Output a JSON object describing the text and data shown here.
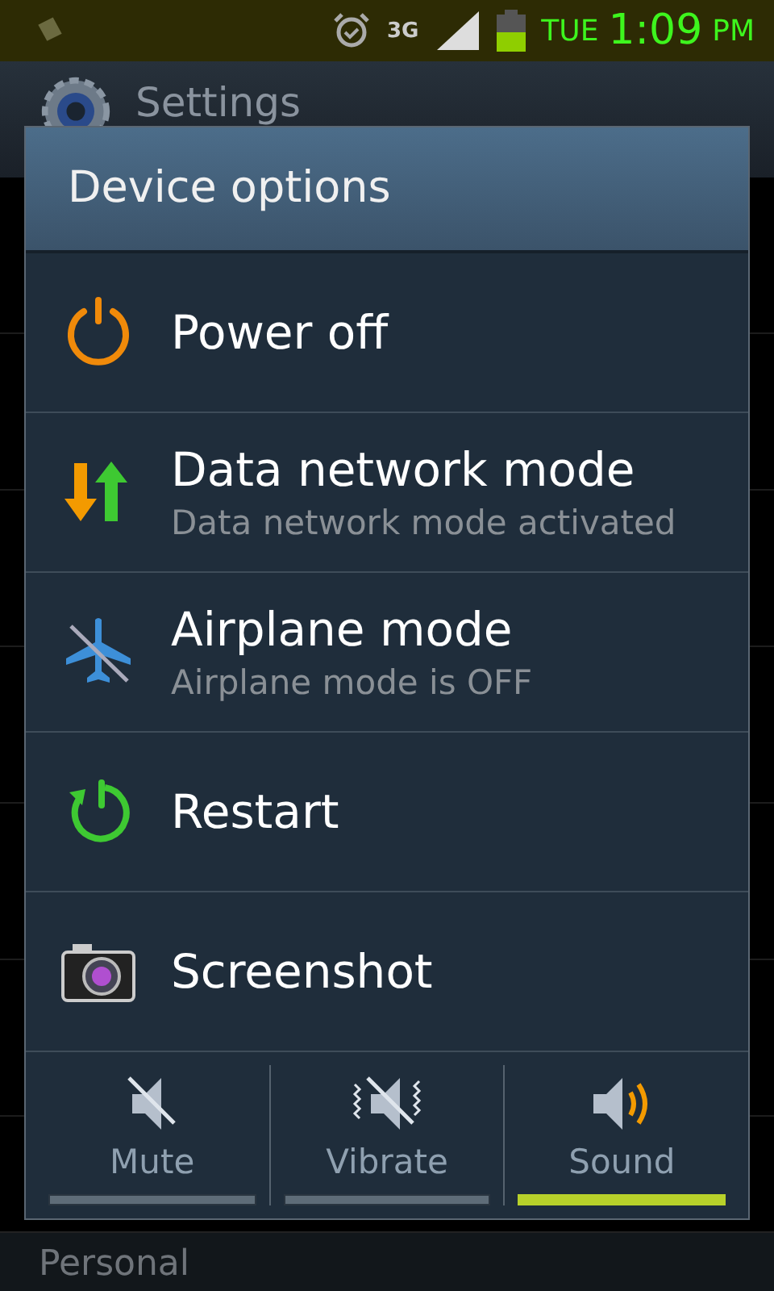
{
  "status_bar": {
    "network": "3G",
    "day": "TUE",
    "time": "1:09",
    "ampm": "PM"
  },
  "app_bar": {
    "title": "Settings"
  },
  "section_header": "Personal",
  "dialog": {
    "title": "Device options",
    "items": [
      {
        "kind": "power",
        "label": "Power off"
      },
      {
        "kind": "data",
        "label": "Data network mode",
        "subtitle": "Data network mode activated"
      },
      {
        "kind": "airplane",
        "label": "Airplane mode",
        "subtitle": "Airplane mode is OFF"
      },
      {
        "kind": "restart",
        "label": "Restart"
      },
      {
        "kind": "screenshot",
        "label": "Screenshot"
      }
    ],
    "sound_modes": [
      {
        "kind": "mute",
        "label": "Mute",
        "selected": false
      },
      {
        "kind": "vibrate",
        "label": "Vibrate",
        "selected": false
      },
      {
        "kind": "sound",
        "label": "Sound",
        "selected": true
      }
    ]
  }
}
